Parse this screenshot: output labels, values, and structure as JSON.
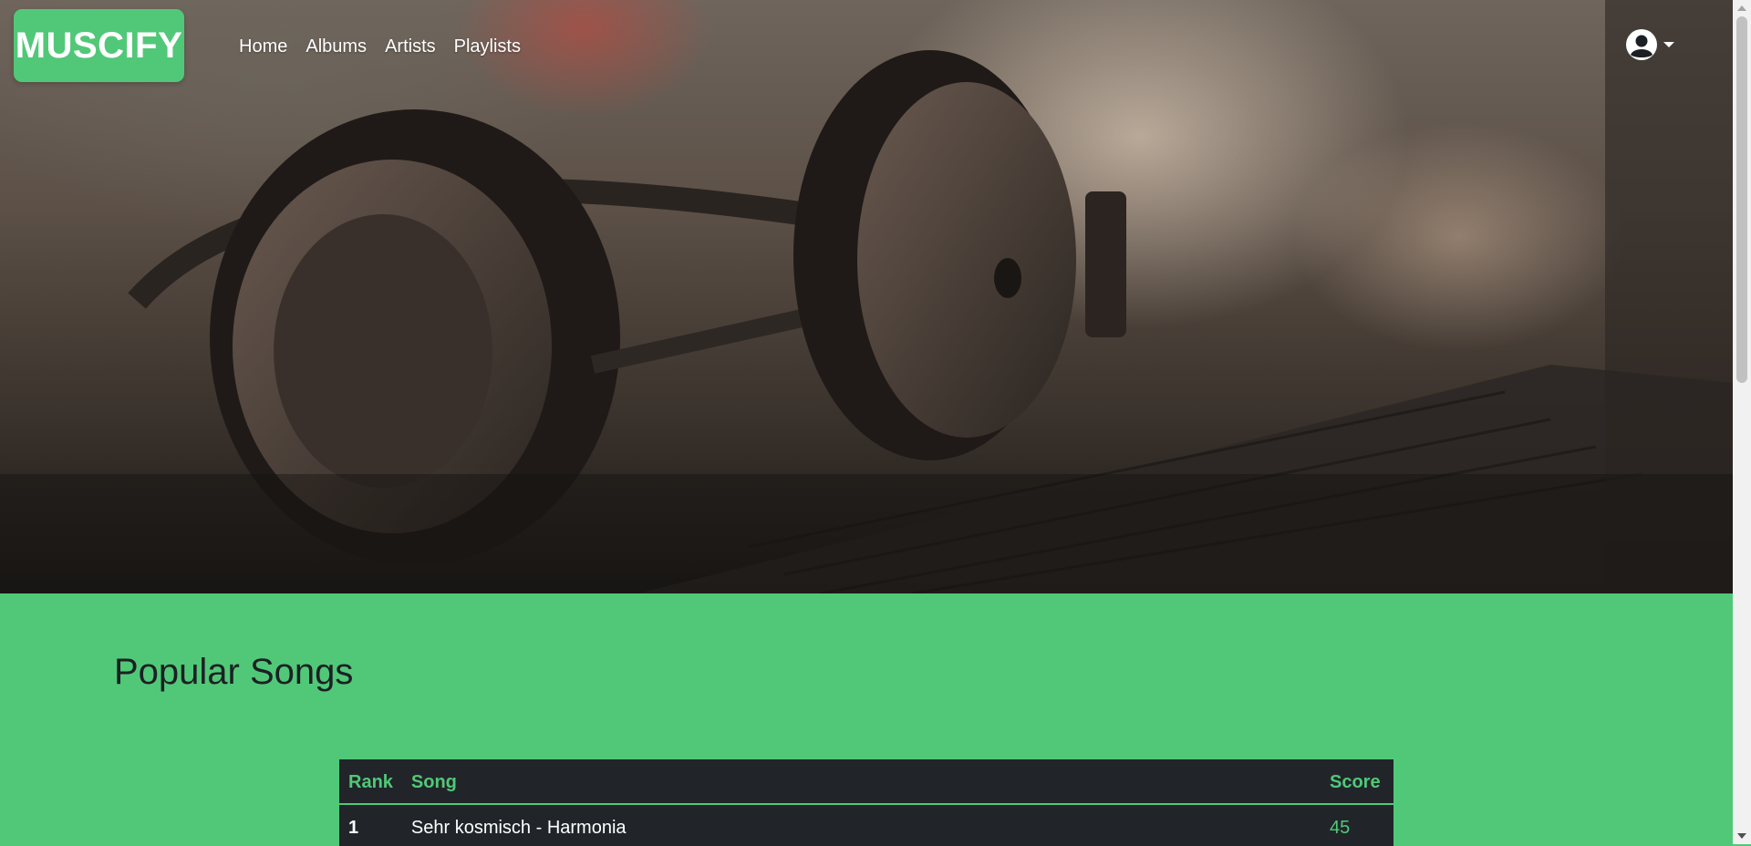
{
  "brand": {
    "name": "MUSCIFY",
    "color": "#51c878"
  },
  "nav": {
    "links": [
      "Home",
      "Albums",
      "Artists",
      "Playlists"
    ],
    "user_icon": "user-circle-icon",
    "caret_icon": "caret-down-icon"
  },
  "hero": {
    "image": "headphones-on-laptop-photo"
  },
  "popular": {
    "title": "Popular Songs",
    "columns": {
      "rank": "Rank",
      "song": "Song",
      "score": "Score"
    },
    "rows": [
      {
        "rank": "1",
        "song": "Sehr kosmisch - Harmonia",
        "score": "45"
      }
    ]
  },
  "colors": {
    "accent": "#51c878",
    "table_bg": "#212529"
  }
}
